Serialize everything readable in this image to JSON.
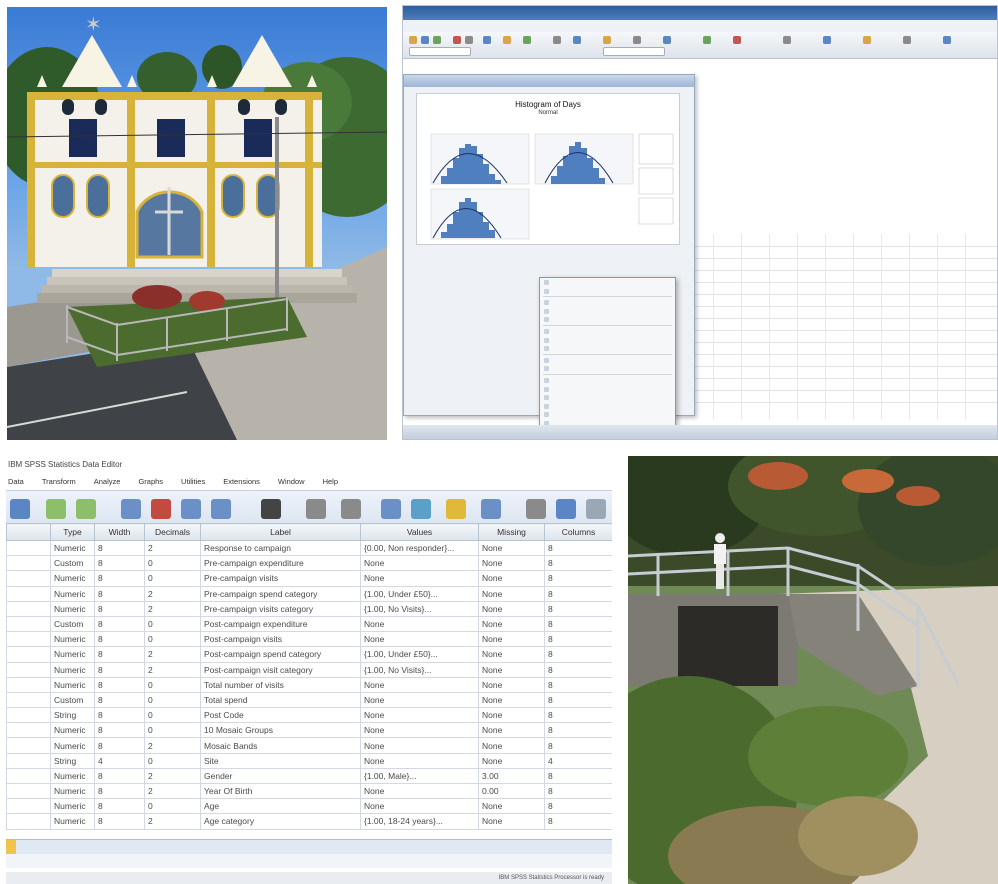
{
  "spss_output": {
    "chart": {
      "title": "Histogram of Days",
      "subtitle": "Normal"
    },
    "status": "IBM SPSS Statistics Processor is ready"
  },
  "variable_view": {
    "window_title": "IBM SPSS Statistics Data Editor",
    "menu": [
      "Data",
      "Transform",
      "Analyze",
      "Graphs",
      "Utilities",
      "Extensions",
      "Window",
      "Help"
    ],
    "columns": [
      "Type",
      "Width",
      "Decimals",
      "Label",
      "Values",
      "Missing",
      "Columns"
    ],
    "rows": [
      {
        "type": "Numeric",
        "width": "8",
        "decimals": "2",
        "label": "Response to campaign",
        "values": "{0.00, Non responder}...",
        "missing": "None",
        "columns": "8"
      },
      {
        "type": "Custom",
        "width": "8",
        "decimals": "0",
        "label": "Pre-campaign expenditure",
        "values": "None",
        "missing": "None",
        "columns": "8"
      },
      {
        "type": "Numeric",
        "width": "8",
        "decimals": "0",
        "label": "Pre-campaign visits",
        "values": "None",
        "missing": "None",
        "columns": "8"
      },
      {
        "type": "Numeric",
        "width": "8",
        "decimals": "2",
        "label": "Pre-campaign spend category",
        "values": "{1.00, Under £50}...",
        "missing": "None",
        "columns": "8"
      },
      {
        "type": "Numeric",
        "width": "8",
        "decimals": "2",
        "label": "Pre-campaign visits category",
        "values": "{1.00, No Visits}...",
        "missing": "None",
        "columns": "8"
      },
      {
        "type": "Custom",
        "width": "8",
        "decimals": "0",
        "label": "Post-campaign expenditure",
        "values": "None",
        "missing": "None",
        "columns": "8"
      },
      {
        "type": "Numeric",
        "width": "8",
        "decimals": "0",
        "label": "Post-campaign visits",
        "values": "None",
        "missing": "None",
        "columns": "8"
      },
      {
        "type": "Numeric",
        "width": "8",
        "decimals": "2",
        "label": "Post-campaign spend category",
        "values": "{1.00, Under £50}...",
        "missing": "None",
        "columns": "8"
      },
      {
        "type": "Numeric",
        "width": "8",
        "decimals": "2",
        "label": "Post-campaign visit category",
        "values": "{1.00, No Visits}...",
        "missing": "None",
        "columns": "8"
      },
      {
        "type": "Numeric",
        "width": "8",
        "decimals": "0",
        "label": "Total number of visits",
        "values": "None",
        "missing": "None",
        "columns": "8"
      },
      {
        "type": "Custom",
        "width": "8",
        "decimals": "0",
        "label": "Total spend",
        "values": "None",
        "missing": "None",
        "columns": "8"
      },
      {
        "type": "String",
        "width": "8",
        "decimals": "0",
        "label": "Post Code",
        "values": "None",
        "missing": "None",
        "columns": "8"
      },
      {
        "type": "Numeric",
        "width": "8",
        "decimals": "0",
        "label": "10 Mosaic Groups",
        "values": "None",
        "missing": "None",
        "columns": "8"
      },
      {
        "type": "Numeric",
        "width": "8",
        "decimals": "2",
        "label": "Mosaic Bands",
        "values": "None",
        "missing": "None",
        "columns": "8"
      },
      {
        "type": "String",
        "width": "4",
        "decimals": "0",
        "label": "Site",
        "values": "None",
        "missing": "None",
        "columns": "4"
      },
      {
        "type": "Numeric",
        "width": "8",
        "decimals": "2",
        "label": "Gender",
        "values": "{1.00, Male}...",
        "missing": "3.00",
        "columns": "8"
      },
      {
        "type": "Numeric",
        "width": "8",
        "decimals": "2",
        "label": "Year Of Birth",
        "values": "None",
        "missing": "0.00",
        "columns": "8"
      },
      {
        "type": "Numeric",
        "width": "8",
        "decimals": "0",
        "label": "Age",
        "values": "None",
        "missing": "None",
        "columns": "8"
      },
      {
        "type": "Numeric",
        "width": "8",
        "decimals": "2",
        "label": "Age category",
        "values": "{1.00, 18-24 years}...",
        "missing": "None",
        "columns": "8"
      }
    ],
    "status": "IBM SPSS Statistics Processor is ready"
  }
}
